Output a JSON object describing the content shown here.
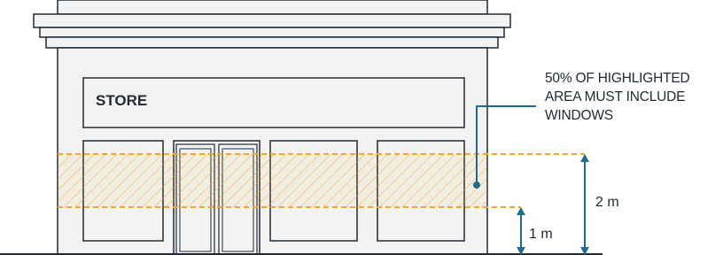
{
  "store_sign": {
    "text": "STORE"
  },
  "annotation": {
    "lines": [
      "50% OF HIGHLIGHTED",
      "AREA MUST INCLUDE",
      "WINDOWS"
    ]
  },
  "dimensions": {
    "upper": "2 m",
    "lower": "1 m"
  },
  "colors": {
    "outline": "#1e2a36",
    "facade_fill": "#f3f3f3",
    "highlight": "#f5a623",
    "leader": "#1f6b8f"
  }
}
